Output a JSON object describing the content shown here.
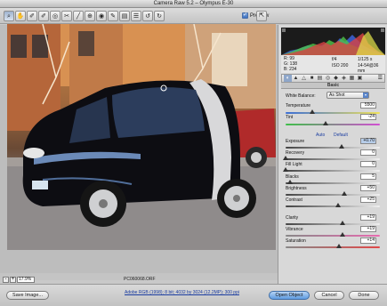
{
  "window": {
    "title": "Camera Raw 5.2  –  Olympus E-30"
  },
  "toolbar": {
    "tools": [
      {
        "name": "zoom-tool-icon",
        "glyph": "⌕"
      },
      {
        "name": "hand-tool-icon",
        "glyph": "✋"
      },
      {
        "name": "white-balance-tool-icon",
        "glyph": "✐"
      },
      {
        "name": "color-sampler-tool-icon",
        "glyph": "✐"
      },
      {
        "name": "targeted-adjustment-tool-icon",
        "glyph": "◎"
      },
      {
        "name": "crop-tool-icon",
        "glyph": "✂"
      },
      {
        "name": "straighten-tool-icon",
        "glyph": "╱"
      },
      {
        "name": "spot-removal-tool-icon",
        "glyph": "⊕"
      },
      {
        "name": "red-eye-tool-icon",
        "glyph": "◉"
      },
      {
        "name": "adjustment-brush-icon",
        "glyph": "✎"
      },
      {
        "name": "graduated-filter-icon",
        "glyph": "▤"
      },
      {
        "name": "preferences-icon",
        "glyph": "☰"
      },
      {
        "name": "rotate-left-icon",
        "glyph": "↺"
      },
      {
        "name": "rotate-right-icon",
        "glyph": "↻"
      }
    ],
    "preview_label": "Preview",
    "preview_checked": "✓",
    "fullscreen_glyph": "⇱"
  },
  "image": {
    "zoom_minus": "-",
    "zoom_plus": "+",
    "zoom_value": "17.9%",
    "filename": "PC060068.ORF",
    "workflow_link": "Adobe RGB (1998); 8 bit; 4032 by 3024 (12.2MP); 300 ppi"
  },
  "readout": {
    "r_label": "R:",
    "r_value": "99",
    "g_label": "G:",
    "g_value": "138",
    "b_label": "B:",
    "b_value": "234",
    "aperture": "f/4",
    "shutter": "1/125 s",
    "iso": "ISO 200",
    "focal": "14-54@36 mm"
  },
  "panel": {
    "tabs": [
      "◐",
      "▲",
      "△",
      "■",
      "▤",
      "◎",
      "◆",
      "◈",
      "▦",
      "▣"
    ],
    "menu_glyph": "☰",
    "section_title": "Basic",
    "white_balance": {
      "label": "White Balance:",
      "value": "As Shot",
      "arrow": "▾"
    },
    "temperature": {
      "label": "Temperature",
      "value": "5500",
      "fraction": 0.28
    },
    "tint": {
      "label": "Tint",
      "value": "-24",
      "fraction": 0.42
    },
    "auto_label": "Auto",
    "default_label": "Default",
    "exposure": {
      "label": "Exposure",
      "value": "+0.70",
      "fraction": 0.59
    },
    "recovery": {
      "label": "Recovery",
      "value": "0",
      "fraction": 0.0
    },
    "fill_light": {
      "label": "Fill Light",
      "value": "0",
      "fraction": 0.0
    },
    "blacks": {
      "label": "Blacks",
      "value": "5",
      "fraction": 0.05
    },
    "brightness": {
      "label": "Brightness",
      "value": "+50",
      "fraction": 0.62
    },
    "contrast": {
      "label": "Contrast",
      "value": "+25",
      "fraction": 0.56
    },
    "clarity": {
      "label": "Clarity",
      "value": "+19",
      "fraction": 0.6
    },
    "vibrance": {
      "label": "Vibrance",
      "value": "+19",
      "fraction": 0.6
    },
    "saturation": {
      "label": "Saturation",
      "value": "+14",
      "fraction": 0.57
    }
  },
  "bottom": {
    "save_label": "Save Image...",
    "open_label": "Open Object",
    "cancel_label": "Cancel",
    "done_label": "Done"
  },
  "colors": {
    "accent": "#5e9be0",
    "link": "#1a3ca0",
    "temp_grad": [
      "#3b6fd6",
      "#f0e25a"
    ],
    "tint_grad": [
      "#3fbf4a",
      "#d24fd2"
    ],
    "neutral_grad": [
      "#444444",
      "#f0f0f0"
    ],
    "vibrance_grad": [
      "#888888",
      "#e86bb0"
    ],
    "saturation_grad": [
      "#888888",
      "#e04848"
    ]
  }
}
